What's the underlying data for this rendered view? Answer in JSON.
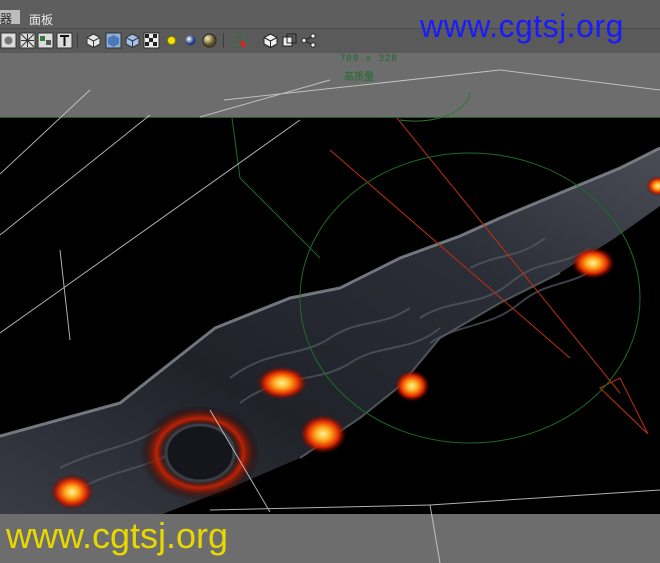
{
  "menubar": {
    "items": [
      {
        "label": "器"
      },
      {
        "label": "面板"
      }
    ]
  },
  "toolbar": {
    "buttons": [
      {
        "name": "render-frame-icon"
      },
      {
        "name": "mesh-icon"
      },
      {
        "name": "scene-icon"
      },
      {
        "name": "text-icon"
      },
      {
        "name": "cube-wire-icon"
      },
      {
        "name": "cube-solid-icon"
      },
      {
        "name": "cube-blue-icon"
      },
      {
        "name": "checker-icon"
      },
      {
        "name": "light-yellow-icon"
      },
      {
        "name": "sphere-blue-icon"
      },
      {
        "name": "sphere-material-icon"
      },
      {
        "name": "select-region-icon"
      },
      {
        "name": "cube-outline-icon"
      },
      {
        "name": "copy-frames-icon"
      },
      {
        "name": "share-nodes-icon"
      }
    ]
  },
  "render": {
    "resolution": "700 x 328",
    "quality": "高质量"
  },
  "watermarks": {
    "top": "www.cgtsj.org",
    "bottom": "www.cgtsj.org"
  },
  "colors": {
    "top_watermark": "#1a1aff",
    "bottom_watermark": "#e8d800",
    "overlay_text": "#1f6d2a",
    "viewport": "#000000"
  }
}
